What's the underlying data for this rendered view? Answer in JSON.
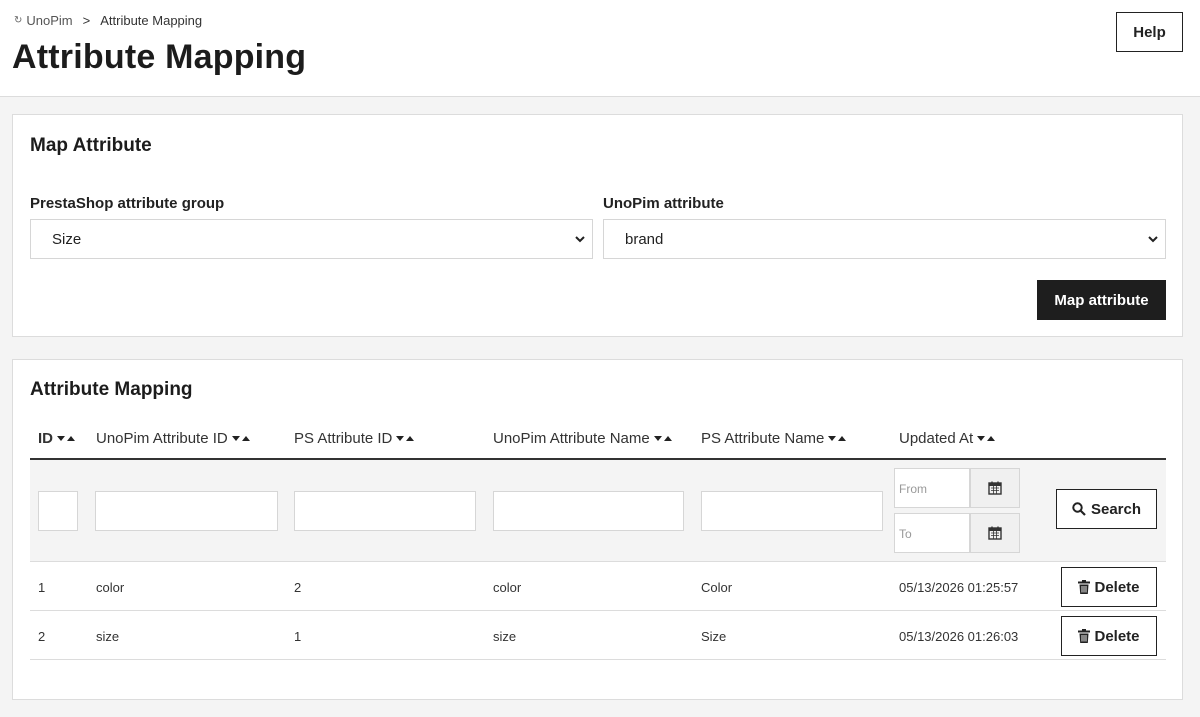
{
  "breadcrumb": {
    "home": "UnoPim",
    "separator": ">",
    "current": "Attribute Mapping"
  },
  "page_title": "Attribute Mapping",
  "help_label": "Help",
  "map_card": {
    "title": "Map Attribute",
    "group_label": "PrestaShop attribute group",
    "group_value": "Size",
    "attr_label": "UnoPim attribute",
    "attr_value": "brand",
    "map_button": "Map attribute"
  },
  "table_card": {
    "title": "Attribute Mapping",
    "columns": [
      "ID",
      "UnoPim Attribute ID",
      "PS Attribute ID",
      "UnoPim Attribute Name",
      "PS Attribute Name",
      "Updated At"
    ],
    "filters": {
      "from_placeholder": "From",
      "to_placeholder": "To",
      "search_label": "Search"
    },
    "rows": [
      {
        "id": "1",
        "unopim_attr_id": "color",
        "ps_attr_id": "2",
        "unopim_attr_name": "color",
        "ps_attr_name": "Color",
        "updated_at": "05/13/2026 01:25:57",
        "delete": "Delete"
      },
      {
        "id": "2",
        "unopim_attr_id": "size",
        "ps_attr_id": "1",
        "unopim_attr_name": "size",
        "ps_attr_name": "Size",
        "updated_at": "05/13/2026 01:26:03",
        "delete": "Delete"
      }
    ]
  },
  "icons": {
    "home": "sync-icon",
    "calendar": "calendar-icon",
    "search": "search-icon",
    "delete": "trash-icon",
    "sort": "sort-arrows-icon",
    "chevron": "chevron-down-icon"
  },
  "colors": {
    "primary_button": "#1e1e1e",
    "background": "#f4f4f4"
  }
}
